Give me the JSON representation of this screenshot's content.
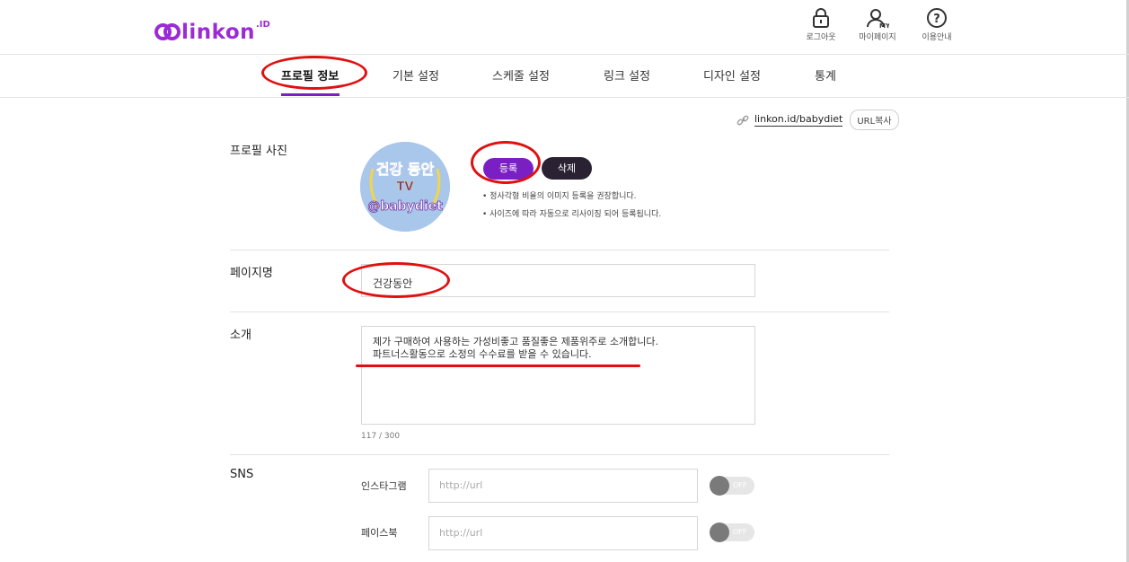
{
  "header": {
    "logo_text": "linkon",
    "logo_sup": ".ID",
    "util": [
      {
        "label": "로그아웃",
        "icon": "lock-icon"
      },
      {
        "label": "마이페이지",
        "icon": "user-icon",
        "badge": "MY"
      },
      {
        "label": "이용안내",
        "icon": "help-icon",
        "glyph": "?"
      }
    ]
  },
  "tabs": [
    {
      "label": "프로필 정보",
      "active": true
    },
    {
      "label": "기본 설정"
    },
    {
      "label": "스케줄 설정"
    },
    {
      "label": "링크 설정"
    },
    {
      "label": "디자인 설정"
    },
    {
      "label": "통계"
    }
  ],
  "url": {
    "text": "linkon.id/babydiet",
    "copy_label": "URL복사"
  },
  "profile_photo": {
    "label": "프로필 사진",
    "avatar_text": {
      "line1": "건강 동안",
      "line2": "TV",
      "line3": "@babydiet"
    },
    "register_label": "등록",
    "delete_label": "삭제",
    "notes": [
      "정사각형 비율의 이미지 등록을 권장합니다.",
      "사이즈에 따라 자동으로 리사이징 되어 등록됩니다."
    ]
  },
  "page_name": {
    "label": "페이지명",
    "value": "건강동안"
  },
  "intro": {
    "label": "소개",
    "value": "제가 구매하여 사용하는 가성비좋고 품질좋은 제품위주로 소개합니다.\n파트너스활동으로 소정의 수수료를 받을 수 있습니다.",
    "counter": "117 / 300"
  },
  "sns": {
    "label": "SNS",
    "items": [
      {
        "label": "인스타그램",
        "placeholder": "http://url",
        "toggle": "OFF"
      },
      {
        "label": "페이스북",
        "placeholder": "http://url",
        "toggle": "OFF"
      }
    ]
  },
  "colors": {
    "accent": "#7a1fc4",
    "annotation": "#e01010",
    "dark_button": "#2a2233"
  }
}
